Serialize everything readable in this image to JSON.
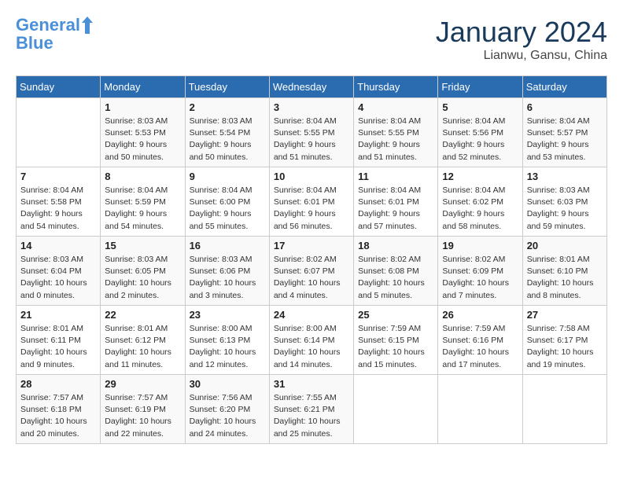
{
  "header": {
    "logo_line1": "General",
    "logo_line2": "Blue",
    "calendar_title": "January 2024",
    "calendar_subtitle": "Lianwu, Gansu, China"
  },
  "days_of_week": [
    "Sunday",
    "Monday",
    "Tuesday",
    "Wednesday",
    "Thursday",
    "Friday",
    "Saturday"
  ],
  "weeks": [
    [
      {
        "day": "",
        "info": ""
      },
      {
        "day": "1",
        "info": "Sunrise: 8:03 AM\nSunset: 5:53 PM\nDaylight: 9 hours\nand 50 minutes."
      },
      {
        "day": "2",
        "info": "Sunrise: 8:03 AM\nSunset: 5:54 PM\nDaylight: 9 hours\nand 50 minutes."
      },
      {
        "day": "3",
        "info": "Sunrise: 8:04 AM\nSunset: 5:55 PM\nDaylight: 9 hours\nand 51 minutes."
      },
      {
        "day": "4",
        "info": "Sunrise: 8:04 AM\nSunset: 5:55 PM\nDaylight: 9 hours\nand 51 minutes."
      },
      {
        "day": "5",
        "info": "Sunrise: 8:04 AM\nSunset: 5:56 PM\nDaylight: 9 hours\nand 52 minutes."
      },
      {
        "day": "6",
        "info": "Sunrise: 8:04 AM\nSunset: 5:57 PM\nDaylight: 9 hours\nand 53 minutes."
      }
    ],
    [
      {
        "day": "7",
        "info": "Sunrise: 8:04 AM\nSunset: 5:58 PM\nDaylight: 9 hours\nand 54 minutes."
      },
      {
        "day": "8",
        "info": "Sunrise: 8:04 AM\nSunset: 5:59 PM\nDaylight: 9 hours\nand 54 minutes."
      },
      {
        "day": "9",
        "info": "Sunrise: 8:04 AM\nSunset: 6:00 PM\nDaylight: 9 hours\nand 55 minutes."
      },
      {
        "day": "10",
        "info": "Sunrise: 8:04 AM\nSunset: 6:01 PM\nDaylight: 9 hours\nand 56 minutes."
      },
      {
        "day": "11",
        "info": "Sunrise: 8:04 AM\nSunset: 6:01 PM\nDaylight: 9 hours\nand 57 minutes."
      },
      {
        "day": "12",
        "info": "Sunrise: 8:04 AM\nSunset: 6:02 PM\nDaylight: 9 hours\nand 58 minutes."
      },
      {
        "day": "13",
        "info": "Sunrise: 8:03 AM\nSunset: 6:03 PM\nDaylight: 9 hours\nand 59 minutes."
      }
    ],
    [
      {
        "day": "14",
        "info": "Sunrise: 8:03 AM\nSunset: 6:04 PM\nDaylight: 10 hours\nand 0 minutes."
      },
      {
        "day": "15",
        "info": "Sunrise: 8:03 AM\nSunset: 6:05 PM\nDaylight: 10 hours\nand 2 minutes."
      },
      {
        "day": "16",
        "info": "Sunrise: 8:03 AM\nSunset: 6:06 PM\nDaylight: 10 hours\nand 3 minutes."
      },
      {
        "day": "17",
        "info": "Sunrise: 8:02 AM\nSunset: 6:07 PM\nDaylight: 10 hours\nand 4 minutes."
      },
      {
        "day": "18",
        "info": "Sunrise: 8:02 AM\nSunset: 6:08 PM\nDaylight: 10 hours\nand 5 minutes."
      },
      {
        "day": "19",
        "info": "Sunrise: 8:02 AM\nSunset: 6:09 PM\nDaylight: 10 hours\nand 7 minutes."
      },
      {
        "day": "20",
        "info": "Sunrise: 8:01 AM\nSunset: 6:10 PM\nDaylight: 10 hours\nand 8 minutes."
      }
    ],
    [
      {
        "day": "21",
        "info": "Sunrise: 8:01 AM\nSunset: 6:11 PM\nDaylight: 10 hours\nand 9 minutes."
      },
      {
        "day": "22",
        "info": "Sunrise: 8:01 AM\nSunset: 6:12 PM\nDaylight: 10 hours\nand 11 minutes."
      },
      {
        "day": "23",
        "info": "Sunrise: 8:00 AM\nSunset: 6:13 PM\nDaylight: 10 hours\nand 12 minutes."
      },
      {
        "day": "24",
        "info": "Sunrise: 8:00 AM\nSunset: 6:14 PM\nDaylight: 10 hours\nand 14 minutes."
      },
      {
        "day": "25",
        "info": "Sunrise: 7:59 AM\nSunset: 6:15 PM\nDaylight: 10 hours\nand 15 minutes."
      },
      {
        "day": "26",
        "info": "Sunrise: 7:59 AM\nSunset: 6:16 PM\nDaylight: 10 hours\nand 17 minutes."
      },
      {
        "day": "27",
        "info": "Sunrise: 7:58 AM\nSunset: 6:17 PM\nDaylight: 10 hours\nand 19 minutes."
      }
    ],
    [
      {
        "day": "28",
        "info": "Sunrise: 7:57 AM\nSunset: 6:18 PM\nDaylight: 10 hours\nand 20 minutes."
      },
      {
        "day": "29",
        "info": "Sunrise: 7:57 AM\nSunset: 6:19 PM\nDaylight: 10 hours\nand 22 minutes."
      },
      {
        "day": "30",
        "info": "Sunrise: 7:56 AM\nSunset: 6:20 PM\nDaylight: 10 hours\nand 24 minutes."
      },
      {
        "day": "31",
        "info": "Sunrise: 7:55 AM\nSunset: 6:21 PM\nDaylight: 10 hours\nand 25 minutes."
      },
      {
        "day": "",
        "info": ""
      },
      {
        "day": "",
        "info": ""
      },
      {
        "day": "",
        "info": ""
      }
    ]
  ]
}
